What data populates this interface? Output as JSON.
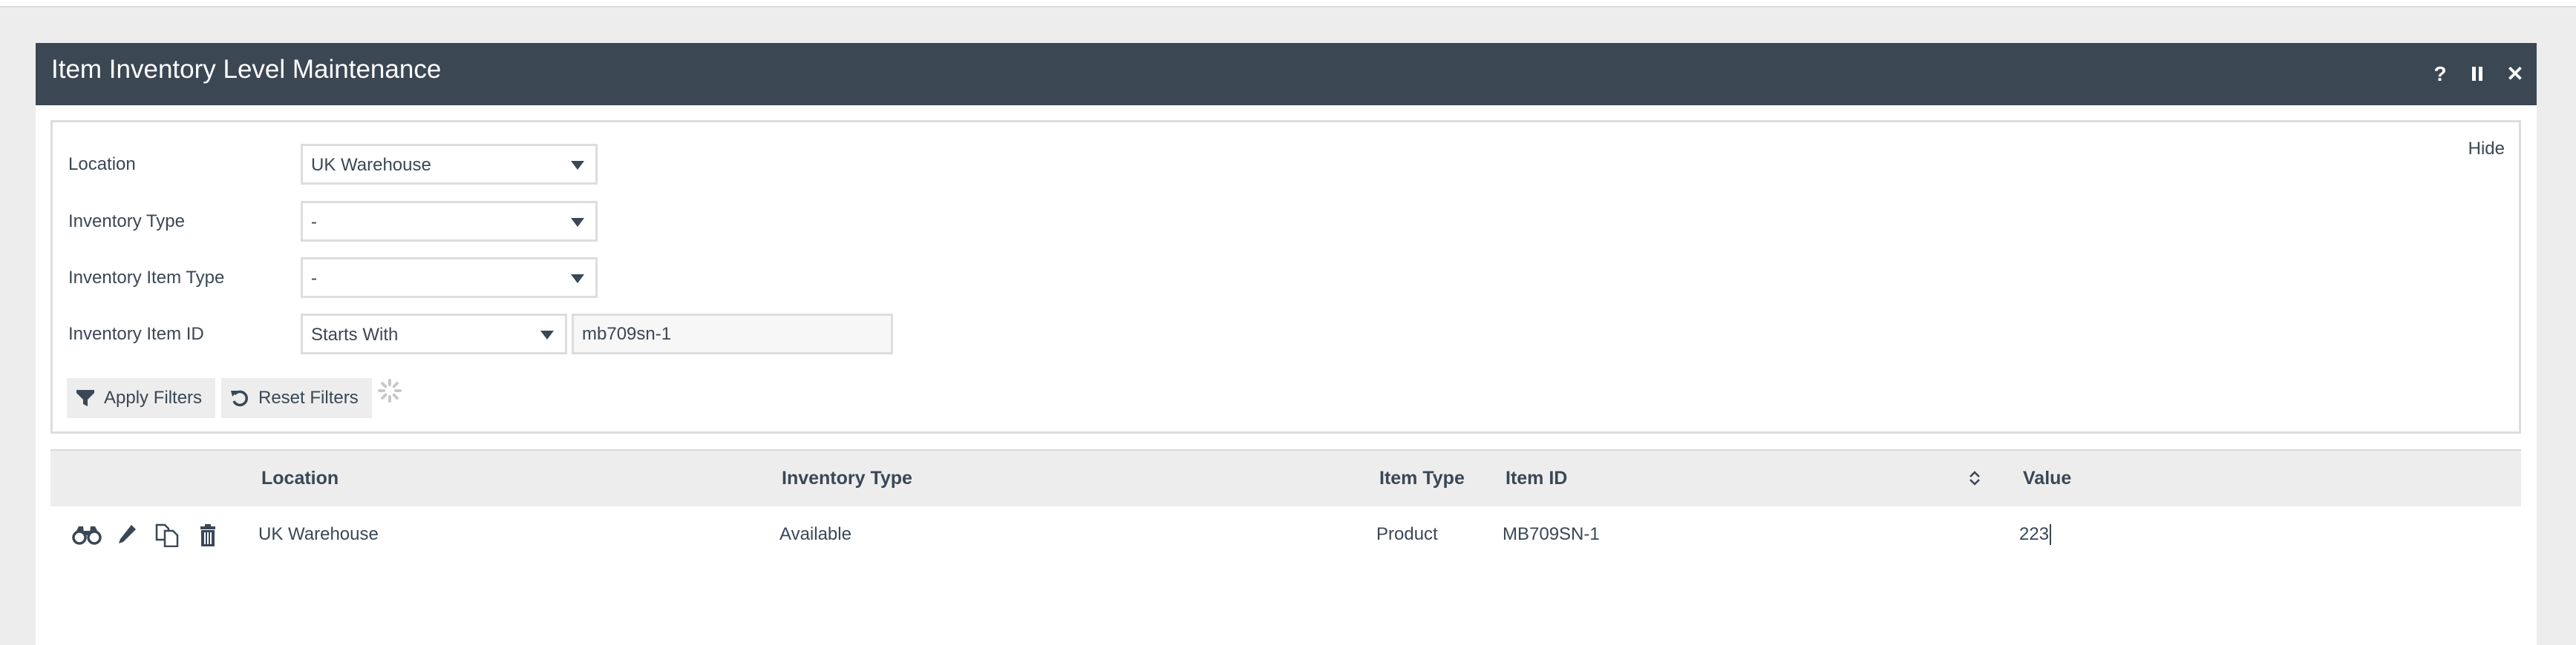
{
  "window": {
    "title": "Item Inventory Level Maintenance",
    "controls": {
      "help": "?",
      "close": "✕"
    }
  },
  "filters": {
    "hide_label": "Hide",
    "location": {
      "label": "Location",
      "value": "UK Warehouse"
    },
    "inventory_type": {
      "label": "Inventory Type",
      "value": "-"
    },
    "inventory_item_type": {
      "label": "Inventory Item Type",
      "value": "-"
    },
    "inventory_item_id": {
      "label": "Inventory Item ID",
      "operator": "Starts With",
      "value": "mb709sn-1"
    },
    "apply_label": "Apply Filters",
    "reset_label": "Reset Filters"
  },
  "table": {
    "columns": [
      "Location",
      "Inventory Type",
      "Item Type",
      "Item ID",
      "Value"
    ],
    "rows": [
      {
        "location": "UK Warehouse",
        "inventory_type": "Available",
        "item_type": "Product",
        "item_id": "MB709SN-1",
        "value": "223"
      }
    ]
  }
}
